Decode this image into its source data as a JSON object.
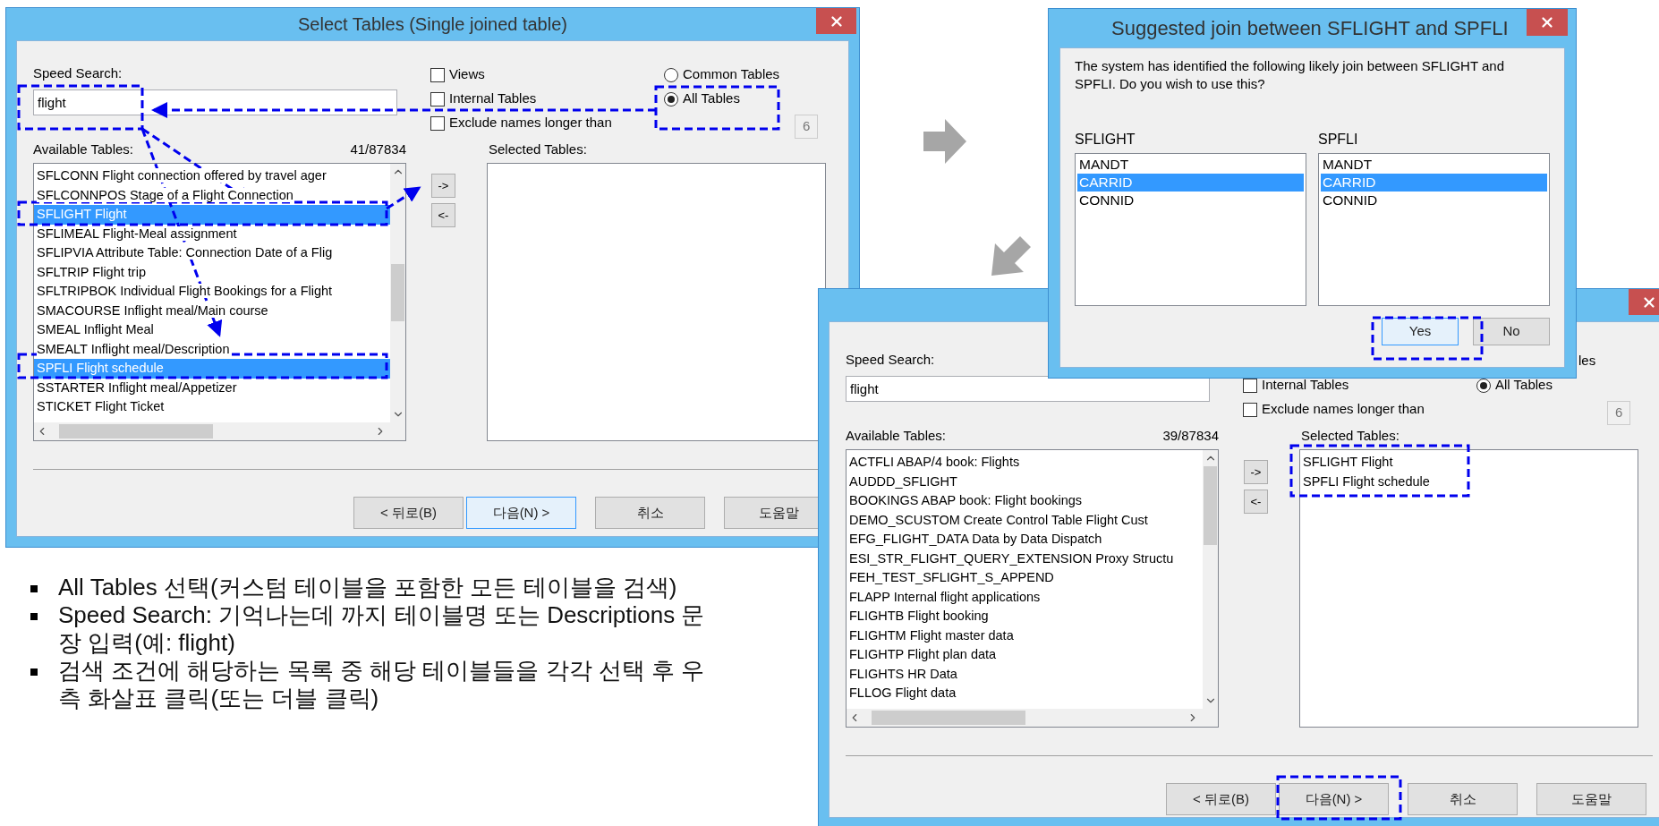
{
  "select_dialog": {
    "title": "Select Tables (Single joined table)",
    "speed_search": {
      "label": "Speed Search:",
      "value": "flight"
    },
    "checkboxes": [
      {
        "label": "Views",
        "checked": false
      },
      {
        "label": "Internal Tables",
        "checked": false
      },
      {
        "label": "Exclude names longer than",
        "checked": false
      }
    ],
    "radios": [
      {
        "label": "Common Tables",
        "selected": false
      },
      {
        "label": "All Tables",
        "selected": true
      }
    ],
    "length_limit": "6",
    "available": {
      "label": "Available Tables:",
      "count": "41/87834",
      "items": [
        {
          "text": "SFLCONN Flight connection offered by travel ager",
          "selected": false
        },
        {
          "text": "SFLCONNPOS Stage of a Flight Connection",
          "selected": false
        },
        {
          "text": "SFLIGHT Flight",
          "selected": true
        },
        {
          "text": "SFLIMEAL Flight-Meal assignment",
          "selected": false
        },
        {
          "text": "SFLIPVIA Attribute Table: Connection Date of a Flig",
          "selected": false
        },
        {
          "text": "SFLTRIP Flight trip",
          "selected": false
        },
        {
          "text": "SFLTRIPBOK Individual Flight Bookings for a Flight",
          "selected": false
        },
        {
          "text": "SMACOURSE Inflight meal/Main course",
          "selected": false
        },
        {
          "text": "SMEAL Inflight Meal",
          "selected": false
        },
        {
          "text": "SMEALT Inflight meal/Description",
          "selected": false
        },
        {
          "text": "SPFLI Flight schedule",
          "selected": true
        },
        {
          "text": "SSTARTER Inflight meal/Appetizer",
          "selected": false
        },
        {
          "text": "STICKET Flight Ticket",
          "selected": false
        }
      ]
    },
    "move_buttons": [
      "->",
      "<-"
    ],
    "selected_tables": {
      "label": "Selected Tables:"
    },
    "buttons": [
      {
        "label": "< 뒤로(B)",
        "default": false
      },
      {
        "label": "다음(N) >",
        "default": true
      },
      {
        "label": "취소",
        "default": false
      },
      {
        "label": "도움말",
        "default": false
      }
    ]
  },
  "join_dialog": {
    "title": "Suggested join between SFLIGHT and SPFLI",
    "message": "The system has identified the following likely join between SFLIGHT and SPFLI. Do you wish to use this?",
    "lists": [
      {
        "label": "SFLIGHT",
        "items": [
          {
            "text": "MANDT",
            "selected": false
          },
          {
            "text": "CARRID",
            "selected": true
          },
          {
            "text": "CONNID",
            "selected": false
          }
        ]
      },
      {
        "label": "SPFLI",
        "items": [
          {
            "text": "MANDT",
            "selected": false
          },
          {
            "text": "CARRID",
            "selected": true
          },
          {
            "text": "CONNID",
            "selected": false
          }
        ]
      }
    ],
    "buttons": [
      {
        "label": "Yes",
        "default": true
      },
      {
        "label": "No",
        "default": false
      }
    ]
  },
  "result_dialog": {
    "speed_search": {
      "label": "Speed Search:",
      "value": "flight"
    },
    "checkboxes": [
      {
        "label": "Internal Tables",
        "checked": false
      },
      {
        "label": "Exclude names longer than",
        "checked": false
      }
    ],
    "radio_fragment": "les",
    "radios": [
      {
        "label": "All Tables",
        "selected": true
      }
    ],
    "length_limit": "6",
    "available": {
      "label": "Available Tables:",
      "count": "39/87834",
      "items": [
        {
          "text": "ACTFLI ABAP/4 book: Flights",
          "selected": false
        },
        {
          "text": "AUDDD_SFLIGHT",
          "selected": false
        },
        {
          "text": "BOOKINGS ABAP book: Flight bookings",
          "selected": false
        },
        {
          "text": "DEMO_SCUSTOM Create Control Table Flight Cust",
          "selected": false
        },
        {
          "text": "EFG_FLIGHT_DATA Data by Data Dispatch",
          "selected": false
        },
        {
          "text": "ESI_STR_FLIGHT_QUERY_EXTENSION Proxy Structu",
          "selected": false
        },
        {
          "text": "FEH_TEST_SFLIGHT_S_APPEND",
          "selected": false
        },
        {
          "text": "FLAPP Internal flight applications",
          "selected": false
        },
        {
          "text": "FLIGHTB Flight booking",
          "selected": false
        },
        {
          "text": "FLIGHTM Flight master data",
          "selected": false
        },
        {
          "text": "FLIGHTP Flight plan data",
          "selected": false
        },
        {
          "text": "FLIGHTS HR Data",
          "selected": false
        },
        {
          "text": "FLLOG Flight data",
          "selected": false
        }
      ]
    },
    "move_buttons": [
      "->",
      "<-"
    ],
    "selected_tables": {
      "label": "Selected Tables:",
      "items": [
        {
          "text": "SFLIGHT Flight",
          "selected": false
        },
        {
          "text": "SPFLI Flight schedule",
          "selected": false
        }
      ]
    },
    "buttons": [
      {
        "label": "< 뒤로(B)",
        "default": false
      },
      {
        "label": "다음(N) >",
        "default": false
      },
      {
        "label": "취소",
        "default": false
      },
      {
        "label": "도움말",
        "default": false
      }
    ]
  },
  "notes": [
    "All Tables 선택(커스텀 테이블을 포함한 모든 테이블을 검색)",
    "Speed Search: 기억나는데 까지 테이블명 또는 Descriptions 문장 입력(예: flight)",
    "검색 조건에 해당하는 목록 중 해당 테이블들을 각각 선택 후 우측 화살표 클릭(또는 더블 클릭)"
  ]
}
